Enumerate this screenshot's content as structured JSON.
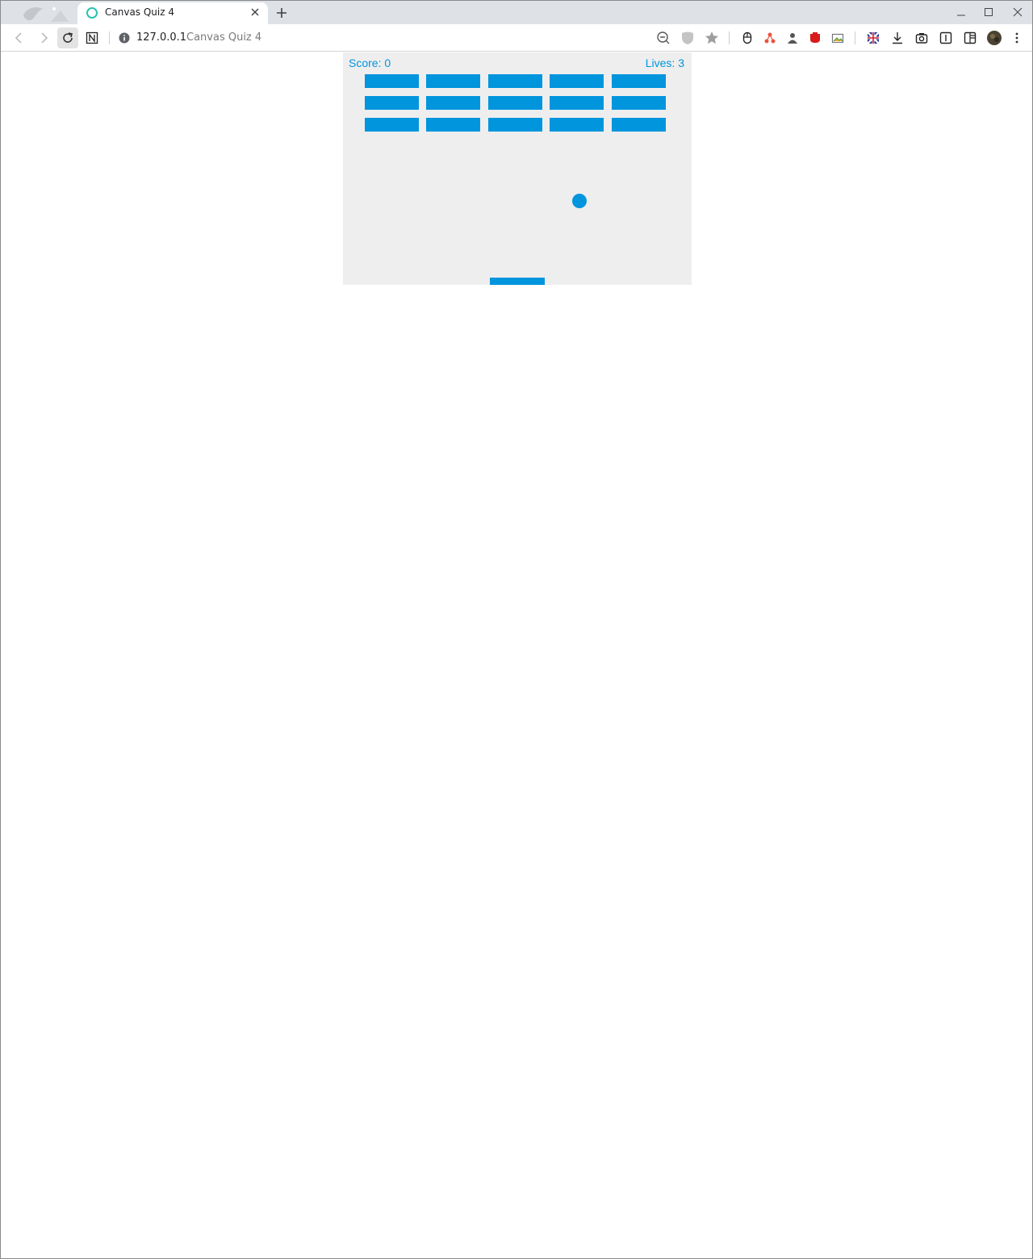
{
  "browser": {
    "tab": {
      "title": "Canvas Quiz 4",
      "favicon": "circle-outline-icon",
      "accent": "#2bc2ad"
    },
    "address": {
      "host": "127.0.0.1",
      "page_title": "Canvas Quiz 4"
    },
    "toolbar_icons": [
      "back-icon",
      "forward-icon",
      "reload-icon",
      "notion-icon",
      "info-icon",
      "zoom-out-icon",
      "shield-icon",
      "bookmark-star-icon",
      "mouse-extension-icon",
      "network-extension-icon",
      "profile-extension-icon",
      "red-extension-icon",
      "image-extension-icon",
      "flag-extension-icon",
      "download-icon",
      "camera-icon",
      "reader-icon",
      "sidebar-icon",
      "avatar",
      "menu-icon"
    ]
  },
  "game": {
    "score_label": "Score: 0",
    "lives_label": "Lives: 3",
    "brick_rows": 3,
    "brick_columns": 5,
    "color": "#0095dd",
    "background": "#eeeeee"
  }
}
